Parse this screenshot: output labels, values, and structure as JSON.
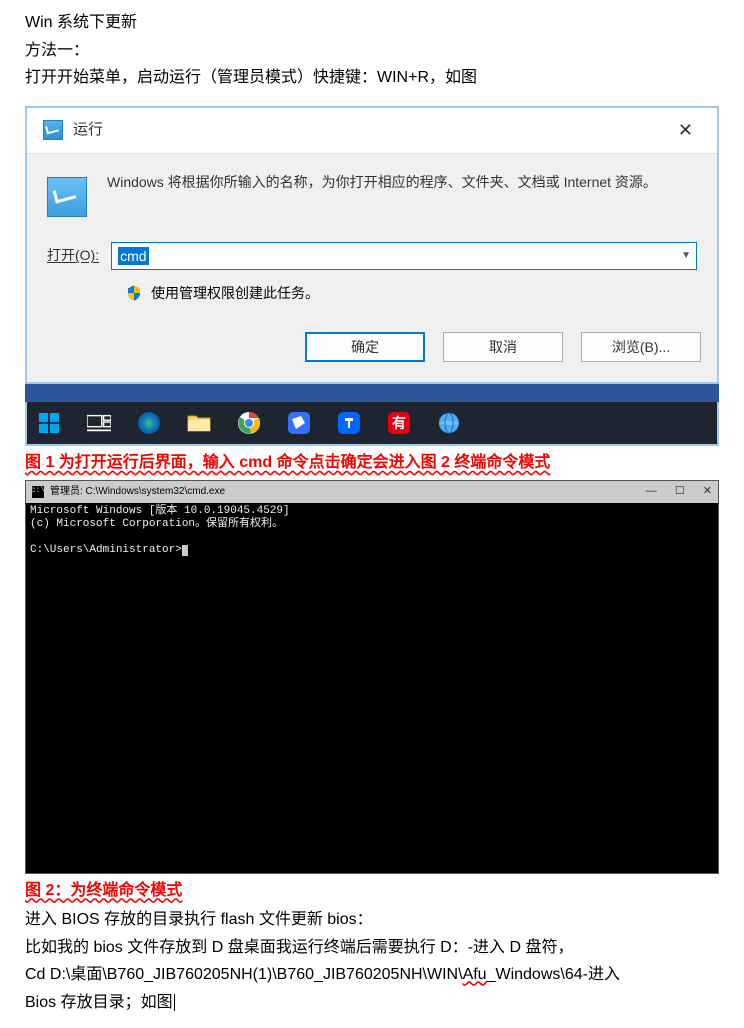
{
  "doc": {
    "line1": "Win 系统下更新",
    "line2": "方法一：",
    "line3": "打开开始菜单，启动运行（管理员模式）快捷键：WIN+R，如图"
  },
  "run": {
    "title": "运行",
    "desc": "Windows 将根据你所输入的名称，为你打开相应的程序、文件夹、文档或 Internet 资源。",
    "openLabel": "打开(O):",
    "inputValue": "cmd",
    "adminText": "使用管理权限创建此任务。",
    "okBtn": "确定",
    "cancelBtn": "取消",
    "browseBtn": "浏览(B)..."
  },
  "caption1": "图 1 为打开运行后界面，输入 cmd 命令点击确定会进入图 2 终端命令模式",
  "terminal": {
    "title": "管理员: C:\\Windows\\system32\\cmd.exe",
    "line1": "Microsoft Windows [版本 10.0.19045.4529]",
    "line2": "(c) Microsoft Corporation。保留所有权利。",
    "prompt": "C:\\Users\\Administrator>"
  },
  "caption2": "图 2：为终端命令模式",
  "doc2": {
    "line1": "进入 BIOS 存放的目录执行 flash 文件更新 bios：",
    "line2_a": "比如我的 bios 文件存放到 D 盘桌面我运行终端后需要执行 D：-进入 D 盘符，",
    "line3_a": "Cd D:\\桌面\\B760_JIB760205NH(1)\\B760_JIB760205NH\\WIN\\",
    "line3_b": "Afu",
    "line3_c": "_Windows\\64-进入",
    "line4": "Bios 存放目录；如图"
  }
}
